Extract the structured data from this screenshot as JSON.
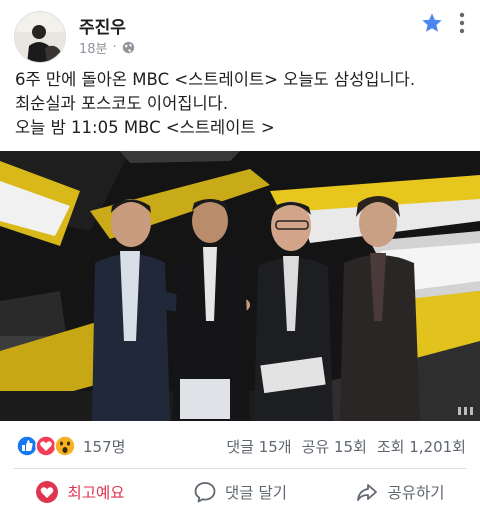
{
  "post": {
    "author": "주진우",
    "time": "18분",
    "text_lines": [
      "6주 만에 돌아온 MBC <스트레이트> 오늘도 삼성입니다.",
      "최순실과 포스코도 이어집니다.",
      "오늘 밤 11:05 MBC <스트레이트 >"
    ]
  },
  "reactions": {
    "count": "157명",
    "types": [
      "like-icon",
      "love-icon",
      "wow-icon"
    ],
    "comments": "댓글 15개",
    "shares": "공유 15회",
    "views": "조회 1,201회"
  },
  "actions": {
    "react_label": "최고예요",
    "comment_label": "댓글 달기",
    "share_label": "공유하기"
  },
  "colors": {
    "accent_blue": "#1877f2",
    "love_red": "#e0354f",
    "muted_text": "#606770"
  }
}
